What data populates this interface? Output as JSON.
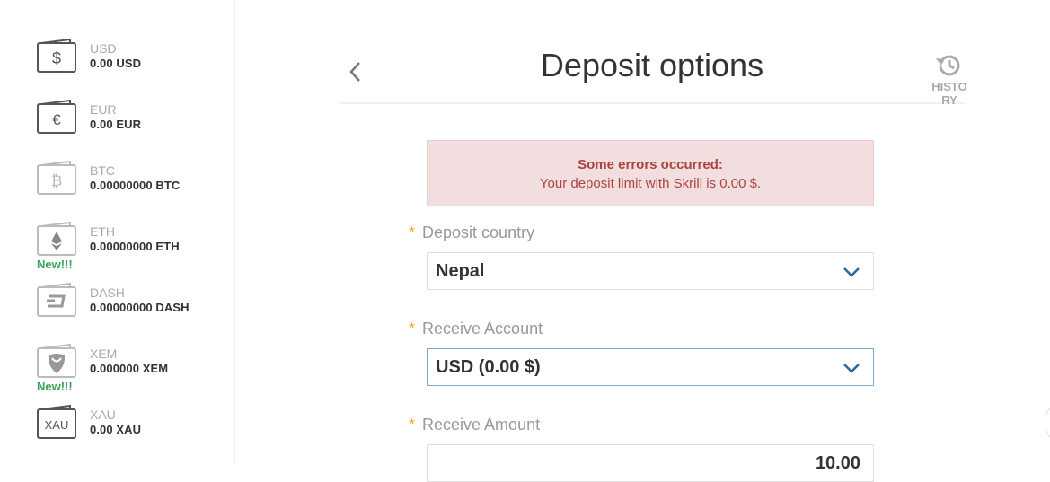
{
  "sidebar": {
    "wallets": [
      {
        "code": "USD",
        "balance": "0.00 USD",
        "icon": "dollar-wallet-icon",
        "new": ""
      },
      {
        "code": "EUR",
        "balance": "0.00 EUR",
        "icon": "euro-wallet-icon",
        "new": ""
      },
      {
        "code": "BTC",
        "balance": "0.00000000 BTC",
        "icon": "bitcoin-wallet-icon",
        "new": ""
      },
      {
        "code": "ETH",
        "balance": "0.00000000 ETH",
        "icon": "ethereum-wallet-icon",
        "new": "New!!!"
      },
      {
        "code": "DASH",
        "balance": "0.00000000 DASH",
        "icon": "dash-wallet-icon",
        "new": ""
      },
      {
        "code": "XEM",
        "balance": "0.000000 XEM",
        "icon": "nem-wallet-icon",
        "new": "New!!!"
      },
      {
        "code": "XAU",
        "balance": "0.00 XAU",
        "icon": "gold-wallet-icon",
        "new": "",
        "icon_text": "XAU"
      }
    ]
  },
  "header": {
    "title": "Deposit options",
    "history_label": "HISTORY",
    "history_icon": "history-icon",
    "back_icon": "chevron-left-icon"
  },
  "alert": {
    "title": "Some errors occurred:",
    "message": "Your deposit limit with Skrill is 0.00 $."
  },
  "form": {
    "country_label": "Deposit country",
    "country_value": "Nepal",
    "account_label": "Receive Account",
    "account_value": "USD (0.00 $)",
    "amount_label": "Receive Amount",
    "amount_value": "10.00",
    "required_mark": "*"
  },
  "colors": {
    "accent": "#2a6a9a",
    "error_bg": "#f2dede",
    "error_text": "#a94442",
    "new_badge": "#3aa35a",
    "required": "#f0a640"
  }
}
